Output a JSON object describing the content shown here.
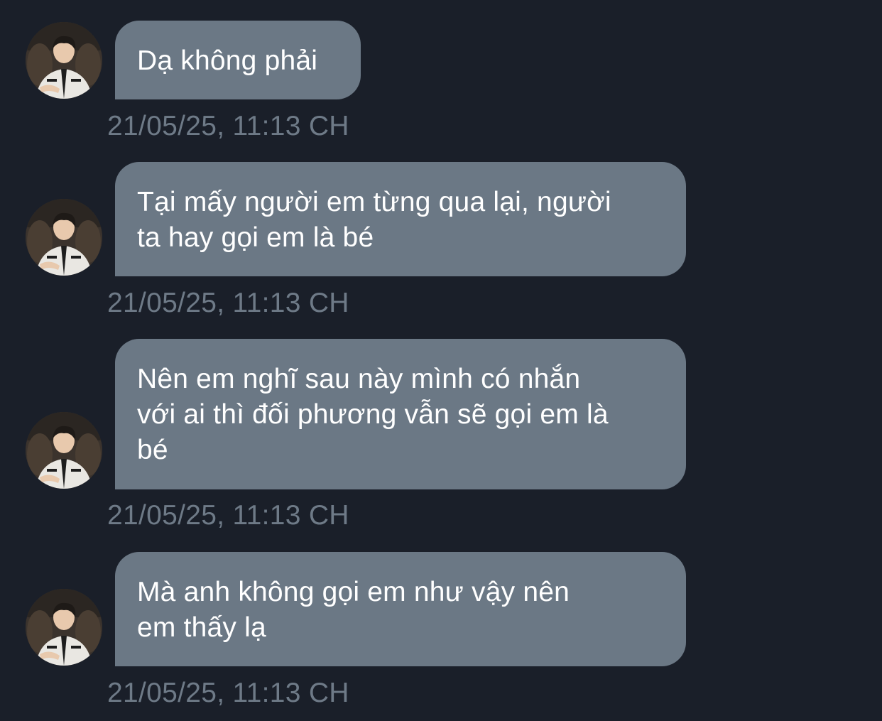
{
  "colors": {
    "background": "#1a1f29",
    "bubble": "#6b7885",
    "bubble_text": "#ffffff",
    "timestamp": "#6e7a87"
  },
  "messages": [
    {
      "text": "Dạ không phải",
      "timestamp": "21/05/25, 11:13 CH",
      "avatar": "profile-photo"
    },
    {
      "text": "Tại mấy người em từng qua lại, người\nta hay gọi em là bé",
      "timestamp": "21/05/25, 11:13 CH",
      "avatar": "profile-photo"
    },
    {
      "text": "Nên em nghĩ sau này mình có  nhắn\nvới ai thì đối phương vẫn sẽ gọi em là\nbé",
      "timestamp": "21/05/25, 11:13 CH",
      "avatar": "profile-photo"
    },
    {
      "text": "Mà anh không gọi em như vậy nên\nem thấy lạ",
      "timestamp": "21/05/25, 11:13 CH",
      "avatar": "profile-photo"
    }
  ]
}
